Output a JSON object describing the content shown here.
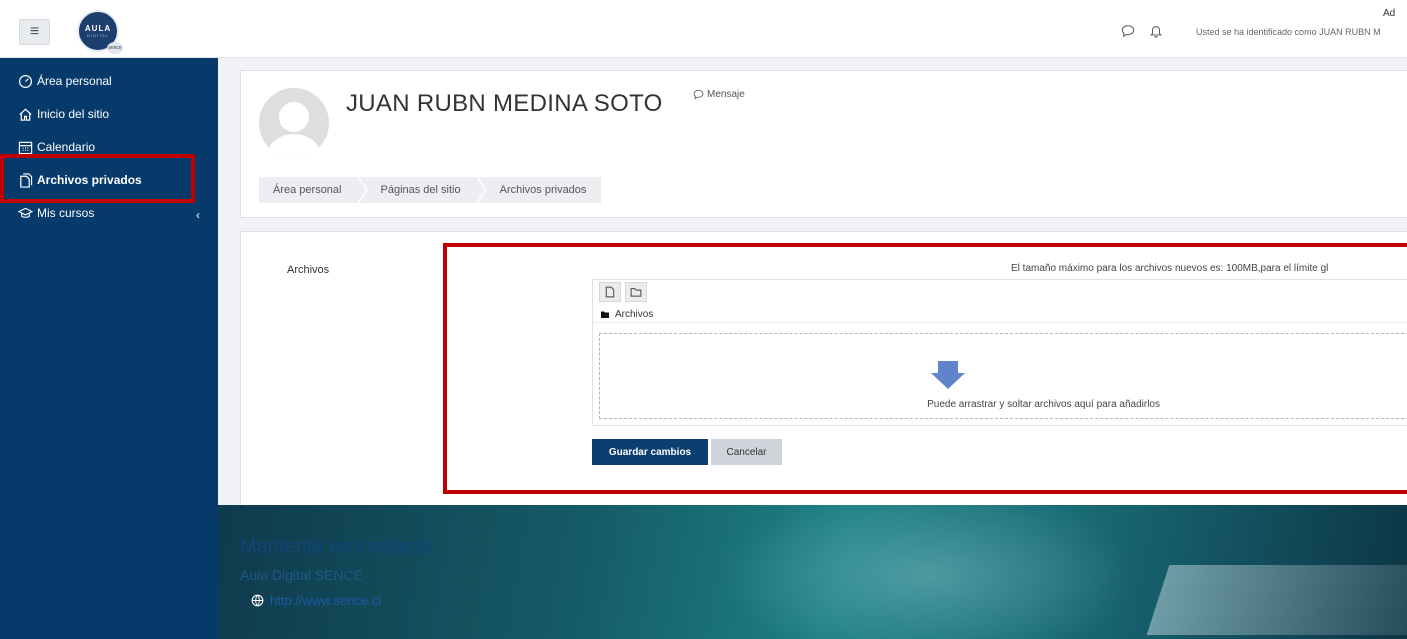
{
  "header": {
    "menu_icon": "hamburger-icon",
    "logo_text_top": "AULA",
    "logo_text_bottom": "DIGITAL",
    "logo_badge": "sence",
    "user_short": "Ad",
    "logged_in_text": "Usted se ha identificado como JUAN RUBN M"
  },
  "sidebar": {
    "items": [
      {
        "label": "Área personal",
        "icon": "dashboard-icon"
      },
      {
        "label": "Inicio del sitio",
        "icon": "home-icon"
      },
      {
        "label": "Calendario",
        "icon": "calendar-icon"
      },
      {
        "label": "Archivos privados",
        "icon": "file-icon"
      },
      {
        "label": "Mis cursos",
        "icon": "graduation-cap-icon"
      }
    ],
    "collapse_icon": "chevron-left-icon"
  },
  "profile": {
    "name": "JUAN RUBN MEDINA SOTO",
    "message_label": "Mensaje"
  },
  "breadcrumb": [
    "Área personal",
    "Páginas del sitio",
    "Archivos privados"
  ],
  "form": {
    "field_label": "Archivos",
    "max_size_text": "El tamaño máximo para los archivos nuevos es: 100MB,para el límite gl",
    "path_label": "Archivos",
    "drop_text": "Puede arrastrar y soltar archivos aquí para añadirlos",
    "save_label": "Guardar cambios",
    "cancel_label": "Cancelar"
  },
  "footer": {
    "title": "Mantente en contacto",
    "subtitle": "Aula Digital SENCE",
    "link": "http://www.sence.cl"
  },
  "colors": {
    "sidebar_bg": "#063a6b",
    "highlight": "#c00000",
    "primary_button": "#0b3f70"
  }
}
